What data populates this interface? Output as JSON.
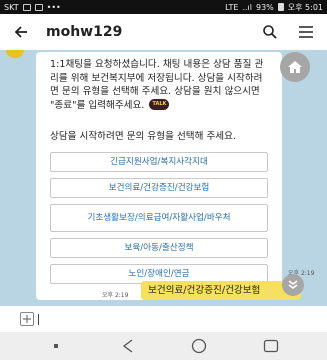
{
  "status_bar": {
    "carrier": "SKT",
    "network": "LTE",
    "signal": "..ıl",
    "battery": "93%",
    "time": "오후 5:01"
  },
  "header": {
    "title": "mohw129"
  },
  "chat": {
    "bot_message_1": "1:1채팅을 요청하셨습니다. 채팅 내용은 상담 품질 관리를 위해 보건복지부에 저장됩니다. 상담을 시작하려면 문의 유형을 선택해 주세요. 상담을 원치 않으시면 \"종료\"를 입력해주세요.",
    "talk_icon": "TALK",
    "bot_message_2": "상담을 시작하려면 문의 유형을 선택해 주세요.",
    "options": [
      "긴급지원사업/복지사각지대",
      "보건의료/건강증진/건강보험",
      "기초생활보장/의료급여/자활사업/바우처",
      "보육/아동/출산정책",
      "노인/장애인/연금"
    ],
    "bot_time": "오후 2:19",
    "user_message": "보건의료/건강증진/건강보험",
    "user_time": "오후 2:19"
  },
  "input": {
    "value": "",
    "placeholder": ""
  },
  "icons": {
    "back": "back-arrow-icon",
    "search": "search-icon",
    "menu": "menu-icon",
    "home": "home-icon",
    "scroll_down": "chevron-down-icon",
    "add": "plus-icon"
  },
  "colors": {
    "chat_background": "#b9d5e3",
    "user_bubble": "#f6e15f",
    "option_text": "#2a6fb0"
  }
}
